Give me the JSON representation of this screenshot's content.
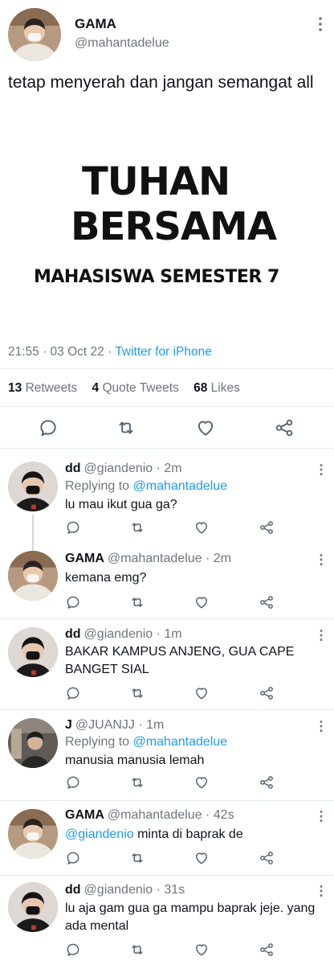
{
  "main_tweet": {
    "name": "GAMA",
    "handle": "@mahantadelue",
    "text": "tetap menyerah dan jangan semangat all",
    "image": {
      "line1": "TUHAN",
      "line2": "BERSAMA",
      "line3": "MAHASISWA SEMESTER 7"
    },
    "time": "21:55 · 03 Oct 22 · ",
    "source": "Twitter for iPhone",
    "stats": {
      "retweets_count": "13",
      "retweets_label": "Retweets",
      "quotes_count": "4",
      "quotes_label": "Quote Tweets",
      "likes_count": "68",
      "likes_label": "Likes"
    }
  },
  "replies": [
    {
      "name": "dd",
      "handle": "@giandenio · 2m",
      "replying_prefix": "Replying to ",
      "replying_to": "@mahantadelue",
      "text": "lu mau ikut gua ga?"
    },
    {
      "name": "GAMA",
      "handle": "@mahantadelue · 2m",
      "text": "kemana emg?"
    },
    {
      "name": "dd",
      "handle": "@giandenio · 1m",
      "text": "BAKAR KAMPUS ANJENG, GUA CAPE BANGET SIAL"
    },
    {
      "name": "J",
      "handle": "@JUANJJ · 1m",
      "replying_prefix": "Replying to ",
      "replying_to": "@mahantadelue",
      "text": "manusia manusia lemah"
    },
    {
      "name": "GAMA",
      "handle": "@mahantadelue · 42s",
      "mention": "@giandenio",
      "text": " minta di baprak de"
    },
    {
      "name": "dd",
      "handle": "@giandenio · 31s",
      "text": "lu aja gam gua ga mampu baprak jeje. yang ada mental"
    }
  ],
  "icons": {
    "reply": "reply-icon",
    "retweet": "retweet-icon",
    "like": "heart-icon",
    "share": "share-icon",
    "more": "more-vertical-icon"
  },
  "colors": {
    "link": "#1d9bf0",
    "secondary_text": "#6e767d",
    "divider": "#e6ecf0"
  }
}
